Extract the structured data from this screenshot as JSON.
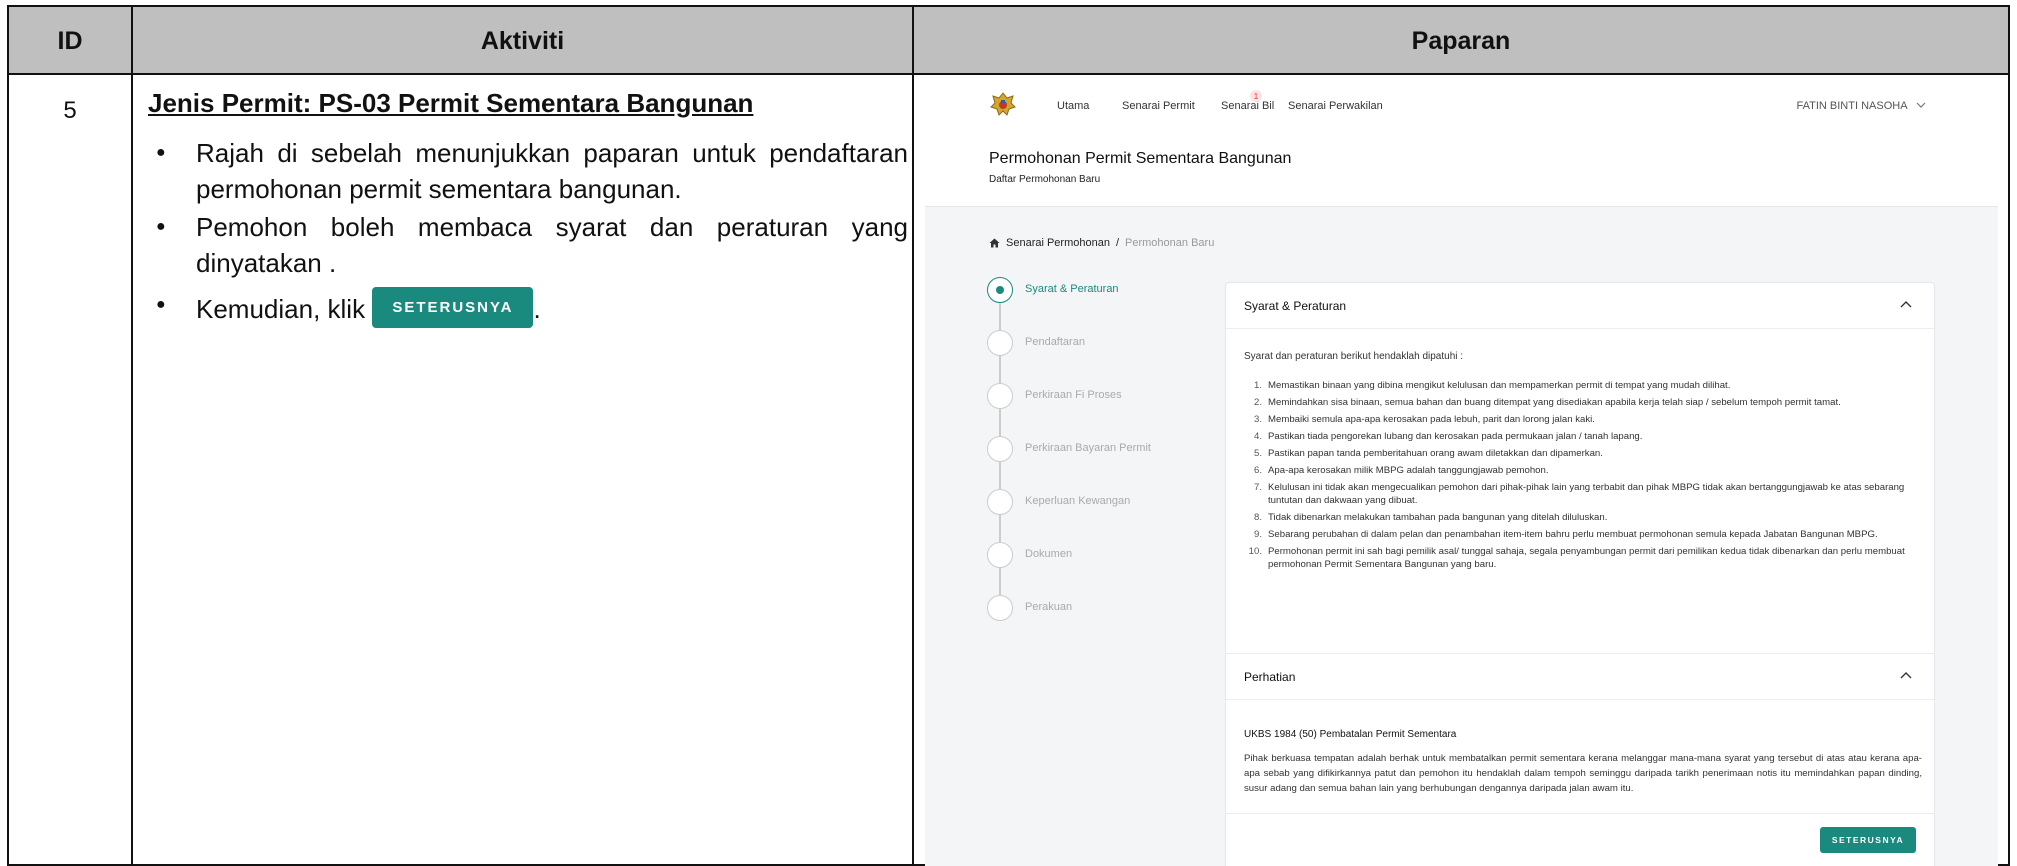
{
  "table": {
    "headers": {
      "id": "ID",
      "aktiviti": "Aktiviti",
      "paparan": "Paparan"
    },
    "row": {
      "id": "5",
      "title": "Jenis Permit: PS-03 Permit Sementara Bangunan",
      "bullets": [
        "Rajah di sebelah menunjukkan paparan untuk pendaftaran permohonan permit sementara bangunan.",
        "Pemohon boleh membaca syarat dan peraturan yang dinyatakan ."
      ],
      "bullet3_prefix": "Kemudian, klik",
      "bullet3_button": "SETERUSNYA",
      "bullet3_suffix": "."
    }
  },
  "screenshot": {
    "nav": [
      "Utama",
      "Senarai Permit",
      "Senarai Bil",
      "Senarai Perwakilan"
    ],
    "badge_count": "1",
    "user_name": "FATIN BINTI NASOHA",
    "page_title": "Permohonan Permit Sementara Bangunan",
    "page_subtitle": "Daftar Permohonan Baru",
    "breadcrumb": {
      "home": "Senarai Permohonan",
      "separator": "/",
      "current": "Permohonan Baru"
    },
    "steps": [
      "Syarat & Peraturan",
      "Pendaftaran",
      "Perkiraan Fi Proses",
      "Perkiraan Bayaran Permit",
      "Keperluan Kewangan",
      "Dokumen",
      "Perakuan"
    ],
    "active_step": 0,
    "section1_title": "Syarat & Peraturan",
    "intro": "Syarat dan peraturan berikut hendaklah dipatuhi :",
    "rules": [
      "Memastikan binaan yang dibina mengikut kelulusan dan mempamerkan permit di tempat yang mudah dilihat.",
      "Memindahkan sisa binaan, semua bahan dan buang ditempat yang disediakan apabila kerja telah siap / sebelum tempoh permit tamat.",
      "Membaiki semula apa-apa kerosakan pada lebuh, parit dan lorong jalan kaki.",
      "Pastikan tiada pengorekan lubang dan kerosakan pada permukaan jalan / tanah lapang.",
      "Pastikan papan tanda pemberitahuan orang awam diletakkan dan dipamerkan.",
      "Apa-apa kerosakan milik MBPG adalah tanggungjawab pemohon.",
      "Kelulusan ini tidak akan mengecualikan pemohon dari pihak-pihak lain yang terbabit dan pihak MBPG tidak akan bertanggungjawab ke atas sebarang tuntutan dan dakwaan yang dibuat.",
      "Tidak dibenarkan melakukan tambahan pada bangunan yang ditelah diluluskan.",
      "Sebarang perubahan di dalam pelan dan penambahan item-item bahru perlu membuat permohonan semula kepada Jabatan Bangunan MBPG.",
      "Permohonan permit ini sah bagi pemilik asal/ tunggal sahaja, segala penyambungan permit dari pemilikan kedua tidak dibenarkan dan perlu membuat permohonan Permit Sementara Bangunan yang baru."
    ],
    "section2_title": "Perhatian",
    "note_title": "UKBS 1984 (50) Pembatalan Permit Sementara",
    "note_text": "Pihak berkuasa tempatan adalah berhak untuk membatalkan permit sementara kerana melanggar mana-mana syarat yang tersebut di atas atau kerana apa-apa sebab yang difikirkannya patut dan pemohon itu hendaklah dalam tempoh seminggu daripada tarikh penerimaan notis itu memindahkan papan dinding, susur adang dan semua bahan lain yang berhubungan dengannya daripada jalan awam itu.",
    "next_button": "SETERUSNYA",
    "accent_color": "#1a8a7e"
  }
}
